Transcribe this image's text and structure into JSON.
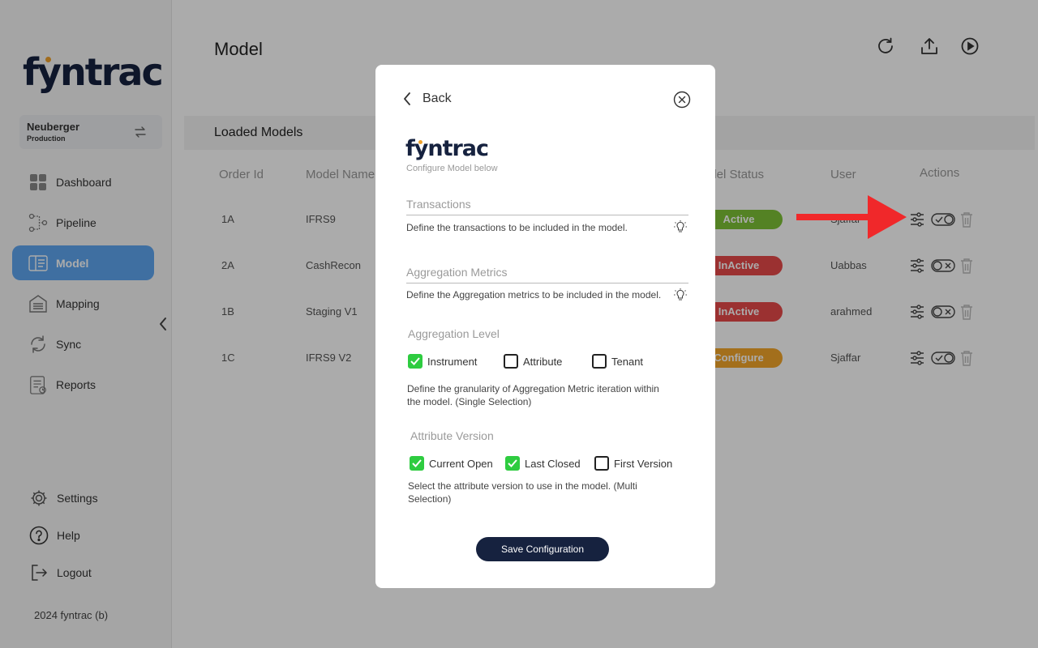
{
  "brand": {
    "logo": "fyntrac",
    "copyright": "2024 fyntrac (b)"
  },
  "tenant": {
    "name": "Neuberger",
    "env": "Production"
  },
  "nav": {
    "items": [
      {
        "label": "Dashboard",
        "icon": "dashboard-icon"
      },
      {
        "label": "Pipeline",
        "icon": "pipeline-icon"
      },
      {
        "label": "Model",
        "icon": "model-icon",
        "active": true
      },
      {
        "label": "Mapping",
        "icon": "mapping-icon"
      },
      {
        "label": "Sync",
        "icon": "sync-icon"
      },
      {
        "label": "Reports",
        "icon": "reports-icon"
      }
    ],
    "bottom": [
      {
        "label": "Settings",
        "icon": "gear-icon"
      },
      {
        "label": "Help",
        "icon": "help-icon"
      },
      {
        "label": "Logout",
        "icon": "logout-icon"
      }
    ]
  },
  "header": {
    "title": "Model"
  },
  "table": {
    "title": "Loaded Models",
    "columns": [
      "Order Id",
      "Model Name",
      "odel Status",
      "User",
      "Actions"
    ],
    "rows": [
      {
        "order_id": "1A",
        "model_name": "IFRS9",
        "status": "Active",
        "user": "Sjaffar"
      },
      {
        "order_id": "2A",
        "model_name": "CashRecon",
        "status": "InActive",
        "user": "Uabbas"
      },
      {
        "order_id": "1B",
        "model_name": "Staging V1",
        "status": "InActive",
        "user": "arahmed"
      },
      {
        "order_id": "1C",
        "model_name": "IFRS9 V2",
        "status": "Configure",
        "user": "Sjaffar"
      }
    ]
  },
  "colors": {
    "active": "#7ec236",
    "inactive": "#e84a4a",
    "configure": "#f4a62a",
    "nav_active": "#5fa6f0",
    "brand_navy": "#16223f",
    "check_green": "#2ecc40",
    "arrow_red": "#f0282a"
  },
  "modal": {
    "back_label": "Back",
    "logo": "fyntrac",
    "subtitle": "Configure Model below",
    "transactions": {
      "placeholder": "Transactions",
      "help": "Define the transactions to be included in the model."
    },
    "aggregation_metrics": {
      "placeholder": "Aggregation Metrics",
      "help": "Define the Aggregation metrics to be included in the model."
    },
    "aggregation_level": {
      "title": "Aggregation Level",
      "options": [
        {
          "label": "Instrument",
          "checked": true
        },
        {
          "label": "Attribute",
          "checked": false
        },
        {
          "label": "Tenant",
          "checked": false
        }
      ],
      "help": "Define the granularity of Aggregation Metric iteration within the model. (Single Selection)"
    },
    "attribute_version": {
      "title": "Attribute Version",
      "options": [
        {
          "label": "Current Open",
          "checked": true
        },
        {
          "label": "Last Closed",
          "checked": true
        },
        {
          "label": "First Version",
          "checked": false
        }
      ],
      "help": "Select the attribute version to use in the model. (Multi Selection)"
    },
    "save_label": "Save Configuration"
  }
}
